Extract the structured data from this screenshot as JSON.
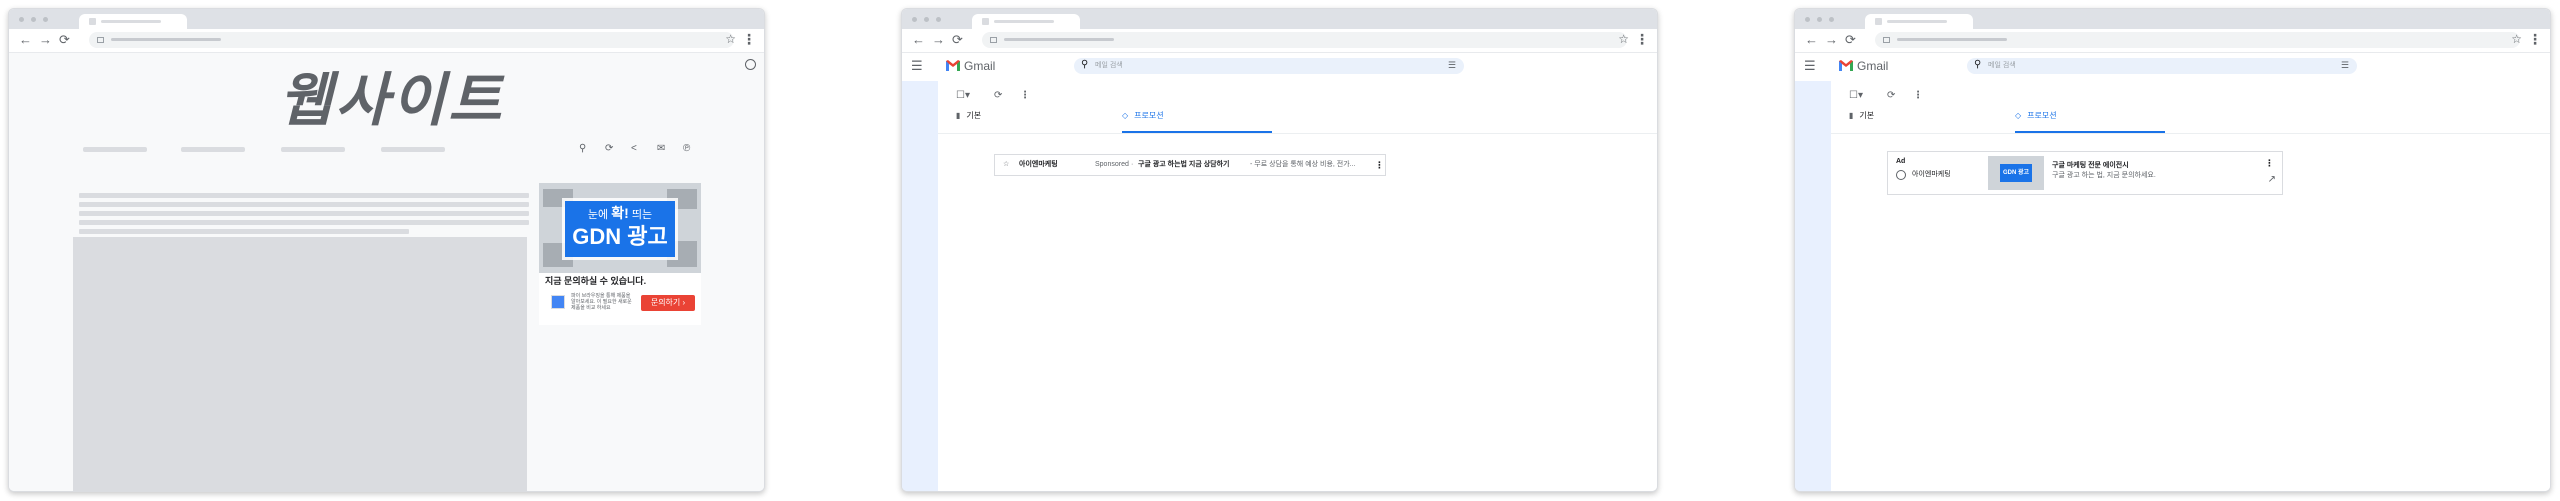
{
  "window1": {
    "site_title": "웹사이트",
    "ad": {
      "headline_pre": "눈에 ",
      "headline_bold": "확!",
      "headline_post": " 띄는",
      "headline_main": "GDN 광고",
      "subtitle": "지금 문의하실 수 있습니다.",
      "description": "파이 브라우징을 통해 제품을 알아보세요. 이 필요한 새로운 제품을 비교 하세요",
      "cta_label": "문의하기 ›"
    }
  },
  "window2": {
    "app_name": "Gmail",
    "search_placeholder": "메일 검색",
    "tabs": [
      {
        "label": "기본"
      },
      {
        "label": "프로모션"
      }
    ],
    "email": {
      "sender": "아이엔마케팅",
      "sponsored": "Sponsored",
      "separator": "·",
      "subject": "구글 광고 하는법 지금 상담하기",
      "snippet": " - 무료 상담을 통해 예상 비용, 전가..."
    }
  },
  "window3": {
    "app_name": "Gmail",
    "search_placeholder": "메일 검색",
    "tabs": [
      {
        "label": "기본"
      },
      {
        "label": "프로모션"
      }
    ],
    "ad": {
      "ad_label": "Ad",
      "advertiser": "아이엔마케팅",
      "thumbnail_text": "GDN 광고",
      "title": "구글 마케팅 전문 에이전시",
      "subtitle": "구글 광고 하는 법, 지금 문의하세요."
    }
  },
  "colors": {
    "accent_blue": "#1a73e8",
    "gmail_red": "#ea4335",
    "chrome_frame": "#dee1e6"
  },
  "icons": {
    "back": "←",
    "forward": "→",
    "reload": "⟳",
    "star": "☆",
    "menu": "☰",
    "search": "🔍",
    "kebab": "⋮",
    "open": "↗"
  }
}
